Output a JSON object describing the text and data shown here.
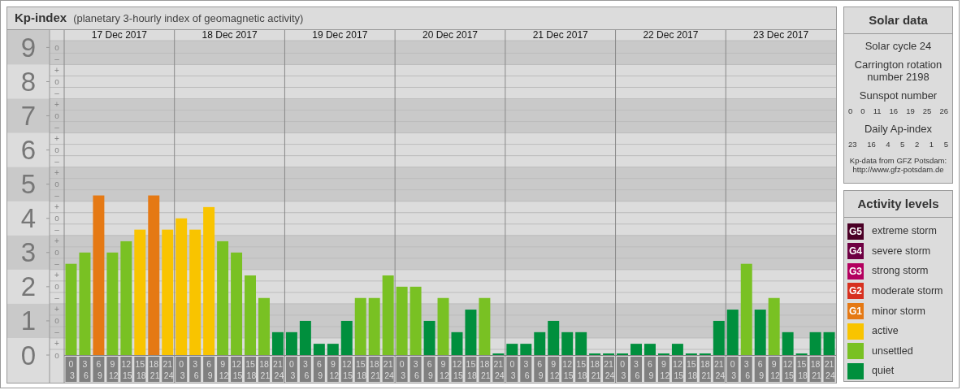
{
  "header": {
    "title": "Kp-index",
    "subtitle": "(planetary 3-hourly index of geomagnetic activity)"
  },
  "kp_chart": {
    "days": [
      "17 Dec 2017",
      "18 Dec 2017",
      "19 Dec 2017",
      "20 Dec 2017",
      "21 Dec 2017",
      "22 Dec 2017",
      "23 Dec 2017"
    ],
    "subdivision_labels": [
      "o",
      "–",
      "+",
      "o",
      "–",
      "+",
      "o",
      "–",
      "+",
      "o",
      "–",
      "+",
      "o",
      "–",
      "+",
      "o",
      "–",
      "+",
      "o",
      "–",
      "+",
      "o",
      "–",
      "+",
      "o",
      "–",
      "+",
      "o"
    ],
    "chart_data": {
      "type": "bar",
      "grid": true,
      "bands": [
        {
          "axis": "y",
          "from": 0.5,
          "to": 1.5,
          "color": "#c9c9c9"
        },
        {
          "axis": "y",
          "from": 2.5,
          "to": 3.5,
          "color": "#c9c9c9"
        },
        {
          "axis": "y",
          "from": 4.5,
          "to": 5.5,
          "color": "#c9c9c9"
        },
        {
          "axis": "y",
          "from": 6.5,
          "to": 7.5,
          "color": "#c9c9c9"
        },
        {
          "axis": "y",
          "from": 8.5,
          "to": 9.2,
          "color": "#c9c9c9"
        }
      ],
      "ylim": [
        0,
        9.2
      ],
      "yticks": [
        0,
        1,
        2,
        3,
        4,
        5,
        6,
        7,
        8,
        9
      ],
      "categories": [
        "0 3",
        "3 6",
        "6 9",
        "9 12",
        "12 15",
        "15 18",
        "18 21",
        "21 24",
        "0 3",
        "3 6",
        "6 9",
        "9 12",
        "12 15",
        "15 18",
        "18 21",
        "21 24",
        "0 3",
        "3 6",
        "6 9",
        "9 12",
        "12 15",
        "15 18",
        "18 21",
        "21 24",
        "0 3",
        "3 6",
        "6 9",
        "9 12",
        "12 15",
        "15 18",
        "18 21",
        "21 24",
        "0 3",
        "3 6",
        "6 9",
        "9 12",
        "12 15",
        "15 18",
        "18 21",
        "21 24",
        "0 3",
        "3 6",
        "6 9",
        "9 12",
        "12 15",
        "15 18",
        "18 21",
        "21 24",
        "0 3",
        "3 6",
        "6 9",
        "9 12",
        "12 15",
        "15 18",
        "18 21",
        "21 24"
      ],
      "series": [
        {
          "name": "quiet",
          "color": "#008f3d",
          "values": [
            null,
            null,
            null,
            null,
            null,
            null,
            null,
            null,
            null,
            null,
            null,
            null,
            null,
            null,
            null,
            0.67,
            0.67,
            1,
            0.33,
            0.33,
            1,
            null,
            null,
            null,
            null,
            null,
            1,
            null,
            0.67,
            1.33,
            null,
            0,
            0.33,
            0.33,
            0.67,
            1,
            0.67,
            0.67,
            0,
            0,
            0,
            0.33,
            0.33,
            0,
            0.33,
            0,
            0,
            1,
            1.33,
            null,
            1.33,
            null,
            0.67,
            0,
            0.67,
            0.67
          ]
        },
        {
          "name": "unsettled",
          "color": "#79c123",
          "values": [
            2.67,
            3,
            null,
            3,
            3.33,
            null,
            null,
            null,
            null,
            null,
            null,
            3.33,
            3,
            2.33,
            1.67,
            null,
            null,
            null,
            null,
            null,
            null,
            1.67,
            1.67,
            2.33,
            2,
            2,
            null,
            1.67,
            null,
            null,
            1.67,
            null,
            null,
            null,
            null,
            null,
            null,
            null,
            null,
            null,
            null,
            null,
            null,
            null,
            null,
            null,
            null,
            null,
            null,
            2.67,
            null,
            1.67,
            null,
            null,
            null,
            null
          ]
        },
        {
          "name": "active",
          "color": "#f9c400",
          "values": [
            null,
            null,
            null,
            null,
            null,
            3.67,
            null,
            3.67,
            4,
            3.67,
            4.33,
            null,
            null,
            null,
            null,
            null,
            null,
            null,
            null,
            null,
            null,
            null,
            null,
            null,
            null,
            null,
            null,
            null,
            null,
            null,
            null,
            null,
            null,
            null,
            null,
            null,
            null,
            null,
            null,
            null,
            null,
            null,
            null,
            null,
            null,
            null,
            null,
            null,
            null,
            null,
            null,
            null,
            null,
            null,
            null,
            null
          ]
        },
        {
          "name": "minor storm",
          "color": "#e57914",
          "values": [
            null,
            null,
            4.67,
            null,
            null,
            null,
            4.67,
            null,
            null,
            null,
            null,
            null,
            null,
            null,
            null,
            null,
            null,
            null,
            null,
            null,
            null,
            null,
            null,
            null,
            null,
            null,
            null,
            null,
            null,
            null,
            null,
            null,
            null,
            null,
            null,
            null,
            null,
            null,
            null,
            null,
            null,
            null,
            null,
            null,
            null,
            null,
            null,
            null,
            null,
            null,
            null,
            null,
            null,
            null,
            null,
            null
          ]
        }
      ]
    }
  },
  "solar_data": {
    "title": "Solar data",
    "solar_cycle": "Solar cycle 24",
    "carrington": "Carrington rotation number 2198",
    "sunspot_title": "Sunspot number",
    "sunspot_numbers": [
      "0",
      "0",
      "11",
      "16",
      "19",
      "25",
      "26"
    ],
    "ap_title": "Daily Ap-index",
    "ap_values": [
      "23",
      "16",
      "4",
      "5",
      "2",
      "1",
      "5"
    ],
    "source": "Kp-data from GFZ Potsdam:",
    "source_url": "http://www.gfz-potsdam.de"
  },
  "activity_levels": {
    "title": "Activity levels",
    "items": [
      {
        "kind": "storm",
        "badge": "G5",
        "label": "extreme storm",
        "color": "#4b0026"
      },
      {
        "kind": "storm",
        "badge": "G4",
        "label": "severe storm",
        "color": "#6e0043"
      },
      {
        "kind": "storm",
        "badge": "G3",
        "label": "strong storm",
        "color": "#b3005f"
      },
      {
        "kind": "storm",
        "badge": "G2",
        "label": "moderate storm",
        "color": "#d7301f"
      },
      {
        "kind": "chart_level",
        "badge": "G1"
      },
      {
        "kind": "chart_level"
      },
      {
        "kind": "chart_level"
      },
      {
        "kind": "chart_level"
      }
    ]
  }
}
